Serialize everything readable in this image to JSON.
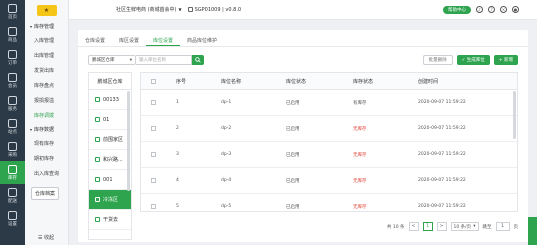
{
  "rail": [
    {
      "label": "首页",
      "icon": "home-icon"
    },
    {
      "label": "商品",
      "icon": "goods-icon"
    },
    {
      "label": "订单",
      "icon": "order-icon"
    },
    {
      "label": "会员",
      "icon": "member-icon"
    },
    {
      "label": "服务",
      "icon": "service-icon"
    },
    {
      "label": "站点",
      "icon": "site-icon"
    },
    {
      "label": "采购",
      "icon": "purchase-icon"
    },
    {
      "label": "库存",
      "icon": "stock-icon"
    },
    {
      "label": "配送",
      "icon": "delivery-icon"
    },
    {
      "label": "设置",
      "icon": "settings-icon"
    }
  ],
  "submenu": {
    "brand": "★",
    "sections": [
      {
        "title": "库存管理",
        "items": [
          "入库管理",
          "出库管理",
          "发货出库",
          "库存盘点",
          "报损报溢",
          "库存调拨"
        ]
      },
      {
        "title": "库存数据",
        "items": [
          "现有库存",
          "期初库存",
          "出入库查询"
        ]
      }
    ],
    "active_item": "库存调拨",
    "button": "仓库档案",
    "collapse": "☰ 收起"
  },
  "header": {
    "store": "社区生鲜电商 (商城首会中)",
    "store_arrow": "▼",
    "account": "SGP01009 | v0.8.0",
    "help": "帮助中心",
    "icons": [
      "bell-icon",
      "help-icon",
      "close-icon",
      "user-icon"
    ]
  },
  "tabs": [
    "仓库设置",
    "库区设置",
    "库位设置",
    "商品库位维护"
  ],
  "active_tab": "库位设置",
  "filter": {
    "select_value": "鹏城区仓库",
    "select_arrow": "▾",
    "search_placeholder": "输入库位名称"
  },
  "actions": {
    "batch_delete": "批量删除",
    "generate": "✓ 生成库位",
    "add": "+ 新增"
  },
  "area": {
    "header": "鹏城区仓库",
    "items": [
      "00133",
      "01",
      "前围家区",
      "和兴路...",
      "001",
      "冷冻区",
      "干货去"
    ],
    "active": "冷冻区"
  },
  "table": {
    "columns": [
      "序号",
      "库位名称",
      "库位状态",
      "库存状态",
      "创建时间"
    ],
    "rows": [
      {
        "no": "1",
        "name": "dp-1",
        "status": "已启用",
        "stock": "有库存",
        "time": "2020-09-07 11:59:22",
        "has": true
      },
      {
        "no": "2",
        "name": "dp-2",
        "status": "已启用",
        "stock": "无库存",
        "time": "2020-09-07 11:59:22",
        "has": false
      },
      {
        "no": "3",
        "name": "dp-3",
        "status": "已启用",
        "stock": "无库存",
        "time": "2020-09-07 11:59:22",
        "has": false
      },
      {
        "no": "4",
        "name": "dp-4",
        "status": "已启用",
        "stock": "无库存",
        "time": "2020-09-07 11:59:22",
        "has": false
      },
      {
        "no": "5",
        "name": "dp-5",
        "status": "已启用",
        "stock": "无库存",
        "time": "2020-09-07 11:59:22",
        "has": false
      }
    ]
  },
  "pager": {
    "total": "共 10 条",
    "prev": "<",
    "page": "1",
    "next": ">",
    "size": "10 条/页",
    "size_arrow": "▾",
    "goto_label": "跳至",
    "goto_value": "1",
    "page_unit": "页"
  },
  "colors": {
    "accent": "#2fa44f",
    "danger": "#e0453a",
    "rail": "#2c3a47"
  }
}
